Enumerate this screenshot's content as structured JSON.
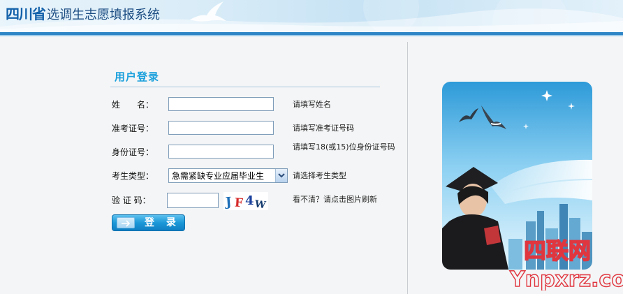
{
  "header": {
    "province": "四川省",
    "system": "选调生志愿填报系统"
  },
  "login": {
    "title": "用户登录",
    "fields": {
      "name": {
        "label": "姓　　名：",
        "value": "",
        "hint": "请填写姓名"
      },
      "exam_id": {
        "label": "准考证号：",
        "value": "",
        "hint": "请填写准考证号码"
      },
      "id_card": {
        "label": "身份证号：",
        "value": "",
        "hint": "请填写18(或15)位身份证号码"
      },
      "candidate_type": {
        "label": "考生类型：",
        "selected": "急需紧缺专业应届毕业生",
        "hint": "请选择考生类型"
      },
      "captcha": {
        "label": "验 证 码：",
        "value": "",
        "image_text": "JF4W",
        "hint": "看不清？请点击图片刷新"
      }
    },
    "submit_label": "登 录"
  },
  "watermark": {
    "cn": "四联网",
    "url": "Ynpxrz.com"
  },
  "colors": {
    "accent": "#1ba0dc",
    "header_band": "#2f86c6",
    "title_blue": "#1361aa",
    "watermark_red": "#e0363f"
  },
  "icons": {
    "header_bird": "dove-icon",
    "button_arrow": "arrow-right-icon",
    "select_arrow": "chevron-down-icon"
  }
}
